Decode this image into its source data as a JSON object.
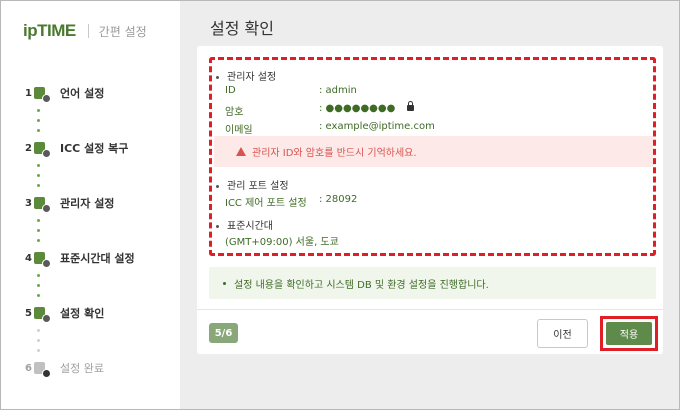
{
  "brand": {
    "logo": "ipTIME",
    "subtitle": "간편 설정"
  },
  "steps": [
    {
      "num": "1",
      "label": "언어 설정",
      "state": "done"
    },
    {
      "num": "2",
      "label": "ICC 설정 복구",
      "state": "done"
    },
    {
      "num": "3",
      "label": "관리자 설정",
      "state": "done"
    },
    {
      "num": "4",
      "label": "표준시간대 설정",
      "state": "done"
    },
    {
      "num": "5",
      "label": "설정 확인",
      "state": "current"
    },
    {
      "num": "6",
      "label": "설정 완료",
      "state": "pending"
    }
  ],
  "page": {
    "title": "설정 확인"
  },
  "admin": {
    "section": "관리자 설정",
    "id_label": "ID",
    "id_value": ": admin",
    "pw_label": "암호",
    "pw_value": ": ●●●●●●●●",
    "email_label": "이메일",
    "email_value": ": example@iptime.com"
  },
  "warning": {
    "text": "관리자 ID와 암호를 반드시 기억하세요."
  },
  "port": {
    "section": "관리 포트 설정",
    "label": "ICC 제어 포트 설정",
    "value": ": 28092"
  },
  "timezone": {
    "section": "표준시간대",
    "value": "(GMT+09:00) 서울, 도쿄"
  },
  "note": {
    "text": "설정 내용을 확인하고 시스템 DB 및 환경 설정을 진행합니다."
  },
  "pager": {
    "text": "5/6"
  },
  "buttons": {
    "prev": "이전",
    "apply": "적용"
  },
  "colors": {
    "accent": "#5e8a4a",
    "highlight": "#e01e26",
    "warning": "#d9534f"
  }
}
